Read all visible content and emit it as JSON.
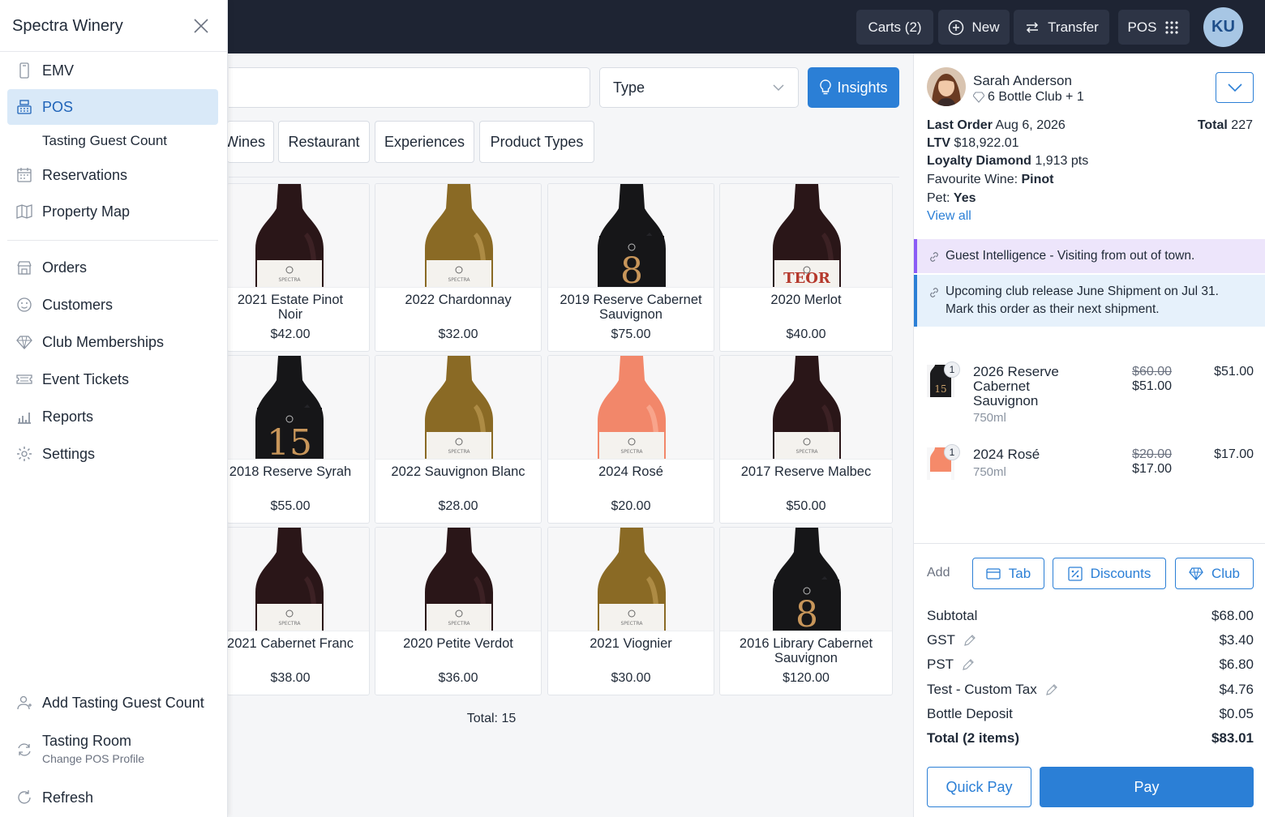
{
  "topbar": {
    "carts_label": "Carts (2)",
    "new_label": "New",
    "transfer_label": "Transfer",
    "pos_label": "POS",
    "avatar_initials": "KU"
  },
  "filters": {
    "type_label": "Type",
    "insights_label": "Insights"
  },
  "tabs": [
    "Wines",
    "Restaurant",
    "Experiences",
    "Product Types"
  ],
  "products": [
    {
      "name": "2021 Estate Pinot Noir",
      "price": "$42.00",
      "bottle": "dark",
      "label": "SPECTRA"
    },
    {
      "name": "2022 Chardonnay",
      "price": "$32.00",
      "bottle": "gold",
      "label": "SPECTRA"
    },
    {
      "name": "2019 Reserve Cabernet Sauvignon",
      "price": "$75.00",
      "bottle": "black",
      "label": "8"
    },
    {
      "name": "2020 Merlot",
      "price": "$40.00",
      "bottle": "dark",
      "label": "TEOR"
    },
    {
      "name": "2018 Reserve Syrah",
      "price": "$55.00",
      "bottle": "black",
      "label": "15"
    },
    {
      "name": "2022 Sauvignon Blanc",
      "price": "$28.00",
      "bottle": "gold",
      "label": "SPECTRA"
    },
    {
      "name": "2024 Rosé",
      "price": "$20.00",
      "bottle": "rose",
      "label": "SPECTRA"
    },
    {
      "name": "2017 Reserve Malbec",
      "price": "$50.00",
      "bottle": "dark",
      "label": "SPECTRA"
    },
    {
      "name": "2021 Cabernet Franc",
      "price": "$38.00",
      "bottle": "dark",
      "label": "SPECTRA"
    },
    {
      "name": "2020 Petite Verdot",
      "price": "$36.00",
      "bottle": "dark",
      "label": "SPECTRA"
    },
    {
      "name": "2021 Viognier",
      "price": "$30.00",
      "bottle": "gold",
      "label": "SPECTRA"
    },
    {
      "name": "2016 Library Cabernet Sauvignon",
      "price": "$120.00",
      "bottle": "black",
      "label": "8"
    }
  ],
  "products_total": "Total: 15",
  "customer": {
    "name": "Sarah Anderson",
    "club": "6 Bottle Club + 1",
    "last_order_label": "Last Order",
    "last_order_value": "Aug 6, 2026",
    "total_label": "Total",
    "total_value": "227",
    "ltv_label": "LTV",
    "ltv_value": "$18,922.01",
    "loyalty_label": "Loyalty Diamond",
    "loyalty_value": "1,913 pts",
    "fav_label": "Favourite Wine:",
    "fav_value": "Pinot",
    "pet_label": "Pet:",
    "pet_value": "Yes",
    "view_all": "View all"
  },
  "alerts": {
    "guest_intel": "Guest Intelligence - Visiting from out of town.",
    "club_release_1": "Upcoming club release June Shipment on Jul 31.",
    "club_release_2": "Mark this order as their next shipment."
  },
  "cart_items": [
    {
      "qty": "1",
      "name": "2026 Reserve Cabernet Sauvignon",
      "size": "750ml",
      "was": "$60.00",
      "now": "$51.00",
      "amount": "$51.00"
    },
    {
      "qty": "1",
      "name": "2024 Rosé",
      "size": "750ml",
      "was": "$20.00",
      "now": "$17.00",
      "amount": "$17.00"
    }
  ],
  "add": {
    "label": "Add",
    "tab": "Tab",
    "discounts": "Discounts",
    "club": "Club"
  },
  "summary": {
    "subtotal_label": "Subtotal",
    "subtotal": "$68.00",
    "gst_label": "GST",
    "gst": "$3.40",
    "pst_label": "PST",
    "pst": "$6.80",
    "custom_tax_label": "Test - Custom Tax",
    "custom_tax": "$4.76",
    "deposit_label": "Bottle Deposit",
    "deposit": "$0.05",
    "total_label": "Total (2 items)",
    "total": "$83.01"
  },
  "actions": {
    "quick_pay": "Quick Pay",
    "pay": "Pay"
  },
  "sidebar": {
    "title": "Spectra Winery",
    "emv": "EMV",
    "pos": "POS",
    "tasting_guest_count": "Tasting Guest Count",
    "reservations": "Reservations",
    "property_map": "Property Map",
    "orders": "Orders",
    "customers": "Customers",
    "club_memberships": "Club Memberships",
    "event_tickets": "Event Tickets",
    "reports": "Reports",
    "settings": "Settings",
    "add_tasting_guest_count": "Add Tasting Guest Count",
    "tasting_room": "Tasting Room",
    "change_pos_profile": "Change POS Profile",
    "refresh": "Refresh"
  },
  "colors": {
    "topbar": "#1e2433",
    "accent": "#2b7fd6",
    "active_nav": "#d9e9f8"
  }
}
